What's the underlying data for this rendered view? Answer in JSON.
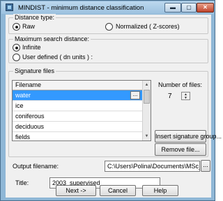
{
  "window": {
    "title": "MINDIST - minimum distance classification",
    "minimize_icon": "minimize-icon",
    "maximize_icon": "maximize-icon",
    "close_icon": "close-icon"
  },
  "distance_type": {
    "label": "Distance type:",
    "options": [
      "Raw",
      "Normalized ( Z-scores)"
    ],
    "selected": "Raw"
  },
  "max_search_distance": {
    "label": "Maximum search distance:",
    "options": [
      "Infinite",
      "User defined ( dn units ) :"
    ],
    "selected": "Infinite"
  },
  "signature_files": {
    "label": "Signature files",
    "column_header": "Filename",
    "rows": [
      "water",
      "ice",
      "coniferous",
      "deciduous",
      "fields"
    ],
    "selected_row": "water",
    "row_button": "...",
    "number_of_files_label": "Number of files:",
    "number_of_files": "7",
    "insert_button": "Insert signature group...",
    "remove_button": "Remove file..."
  },
  "output": {
    "label": "Output filename:",
    "value": "C:\\Users\\Polina\\Documents\\MSc_C",
    "browse_button": "..."
  },
  "title_field": {
    "label": "Title:",
    "value": "2003_supervised"
  },
  "footer": {
    "next": "Next ->",
    "cancel": "Cancel",
    "help": "Help"
  },
  "colors": {
    "selection": "#3399ff",
    "frame": "#8fb7d6",
    "close_button": "#c0442c"
  }
}
